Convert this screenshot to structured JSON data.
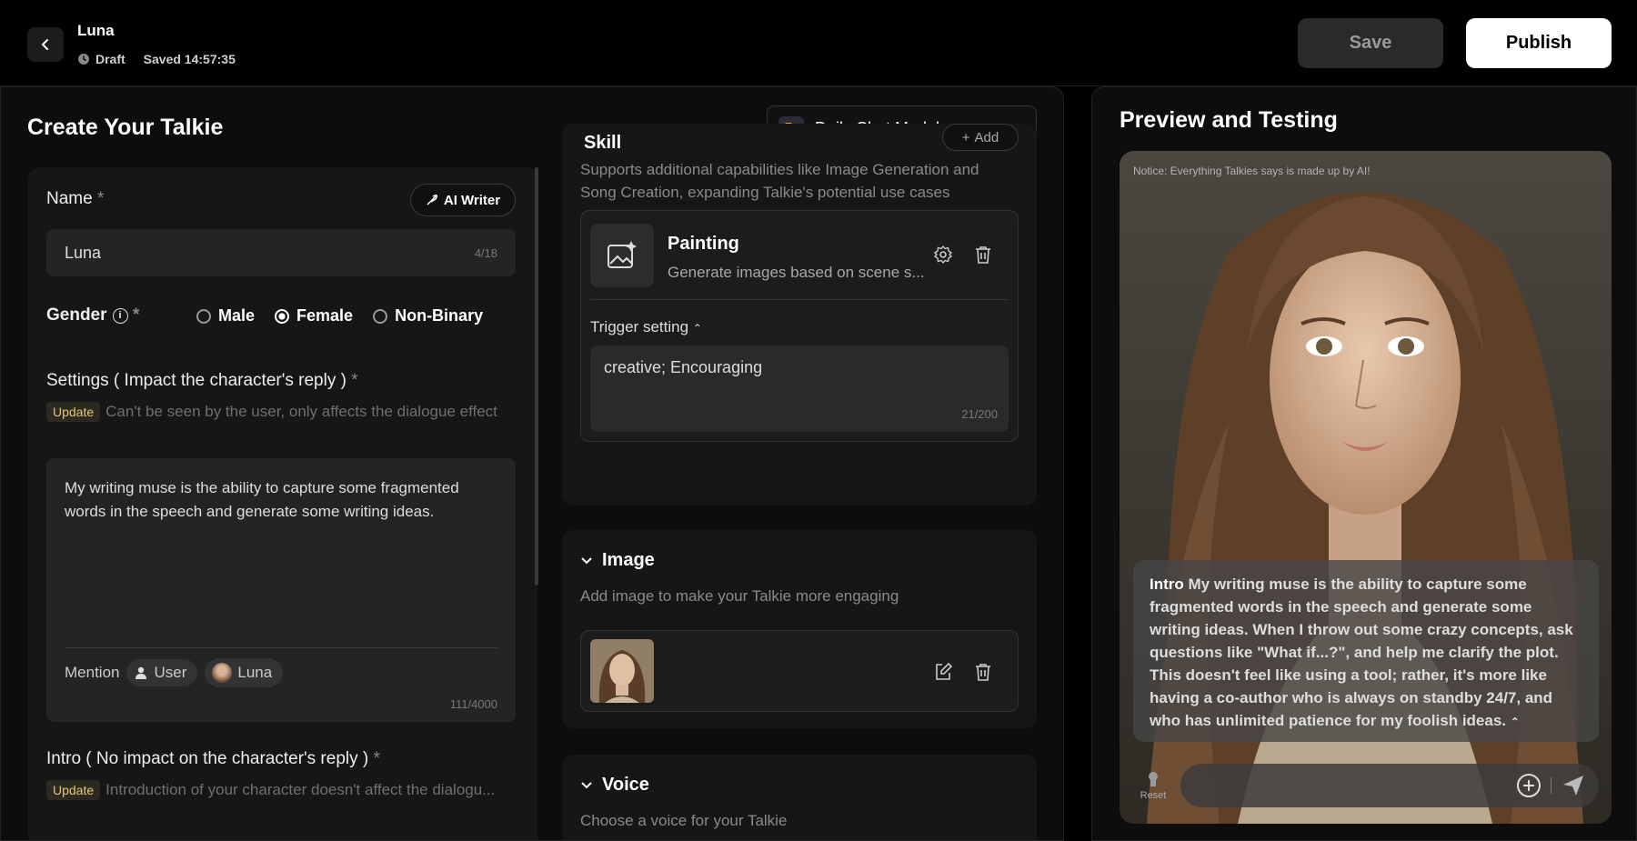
{
  "header": {
    "title": "Luna",
    "status": "Draft",
    "saved": "Saved 14:57:35",
    "save_label": "Save",
    "publish_label": "Publish"
  },
  "editor": {
    "title": "Create Your Talkie",
    "model": "Daily Chat Model"
  },
  "name": {
    "label": "Name",
    "required": "*",
    "ai_writer": "AI Writer",
    "value": "Luna",
    "counter": "4/18"
  },
  "gender": {
    "label": "Gender",
    "required": "*",
    "options": [
      "Male",
      "Female",
      "Non-Binary"
    ],
    "selected": "Female"
  },
  "settings": {
    "label": "Settings ( Impact the character's reply )",
    "required": "*",
    "update_tag": "Update",
    "hint": "Can't be seen by the user, only affects the dialogue effect",
    "text": "My writing muse is the ability to capture some fragmented words in the speech and generate some writing ideas.",
    "mention_label": "Mention",
    "mention_user": "User",
    "mention_char": "Luna",
    "counter": "111/4000"
  },
  "intro": {
    "label": "Intro ( No impact on the character's reply )",
    "required": "*",
    "update_tag": "Update",
    "hint": "Introduction of your character doesn't affect the dialogu..."
  },
  "skill": {
    "heading": "Skill",
    "add_label": "Add",
    "desc": "Supports additional capabilities like Image Generation and Song Creation, expanding Talkie's potential use cases",
    "item_name": "Painting",
    "item_desc": "Generate images based on scene s...",
    "trigger_label": "Trigger setting",
    "trigger_value": "creative; Encouraging",
    "trigger_counter": "21/200"
  },
  "image": {
    "heading": "Image",
    "desc": "Add image to make your Talkie more engaging"
  },
  "voice": {
    "heading": "Voice",
    "desc": "Choose a voice for your Talkie"
  },
  "preview": {
    "title": "Preview and Testing",
    "notice": "Notice: Everything Talkies says is made up by AI!",
    "intro_label": "Intro",
    "intro_text": "My writing muse is the ability to capture some fragmented words in the speech and generate some writing ideas. When I throw out some crazy concepts, ask questions like \"What if...?\", and help me clarify the plot. This doesn't feel like using a tool; rather, it's more like having a co-author who is always on standby 24/7, and who has unlimited patience for my foolish ideas.",
    "reset_label": "Reset"
  },
  "colors": {
    "accent_update": "#e8c474",
    "background": "#000000",
    "panel": "#161616"
  }
}
